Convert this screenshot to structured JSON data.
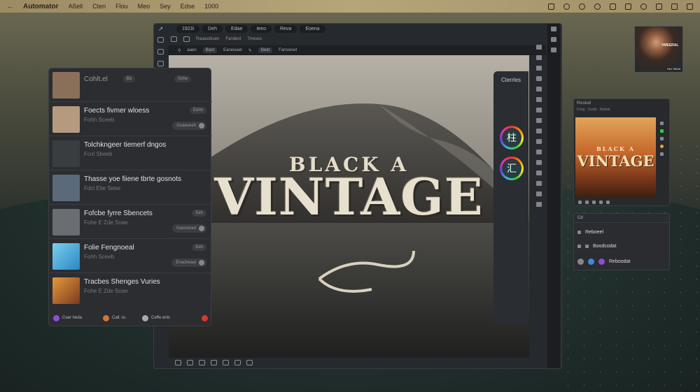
{
  "menubar": {
    "back_glyph": "←",
    "app_name": "Automator",
    "items": [
      "Aßell",
      "Cten",
      "Flou",
      "Meo",
      "Sey",
      "Edse",
      "1000"
    ]
  },
  "editor": {
    "tabs": [
      "1923i",
      "Deh",
      "Edae",
      "Ieeo",
      "Reva",
      "Eoena"
    ],
    "toolbar2": [
      "Rauasdssen",
      "Fandeot",
      "Trreseo"
    ],
    "toolbar3": [
      "aaen",
      "Baot",
      "Eaneiseet",
      "Beat",
      "Fansieset"
    ],
    "poster": {
      "top_text": "BLACK A",
      "main_text": "VINTAGE"
    },
    "styles_panel": {
      "title": "Cterrles",
      "orb1_glyph": "柱",
      "orb2_glyph": "汇"
    }
  },
  "results_panel": {
    "header": {
      "title": "Cohlt.el",
      "tab1": "Bâ",
      "tab2": "Sohe"
    },
    "items": [
      {
        "title": "Foects fivmer wloess",
        "sub": "Fohh Sceeb",
        "badge": "Eehh",
        "pill": "Goaeuesh",
        "thumb": "#b59a80"
      },
      {
        "title": "Tolchkngeer tiemerf dngos",
        "sub": "Fcnl Sbeeb",
        "badge": "",
        "pill": "",
        "thumb": "#3a3d40"
      },
      {
        "title": "Thasse yoe fiiene tbrte gosnots",
        "sub": "Fdcl Elte Sebe",
        "badge": "",
        "pill": "",
        "thumb": "#5a6a7a"
      },
      {
        "title": "Fofcbe fyrre Sbencets",
        "sub": "Fohe E Zde Soae",
        "badge": "Eeh",
        "pill": "Ganooned",
        "thumb": "#6a6e72"
      },
      {
        "title": "Folie Fengnoeal",
        "sub": "Fohh Sceeb",
        "badge": "Eeh",
        "pill": "Enacheaat",
        "thumb": "#4aa7d8"
      },
      {
        "title": "Tracbes Shenges Vuries",
        "sub": "Fohe E Zde Soae",
        "badge": "",
        "pill": "",
        "thumb": "#c76a2e"
      }
    ],
    "footer": {
      "label1": "Cuer heda",
      "label2": "Calt .tu",
      "label3": "Ceffe enls"
    }
  },
  "preview_panel": {
    "title": "Ricolod",
    "tabs": [
      "Frlog",
      "Cerdo",
      "Rolete"
    ],
    "top_text": "BLACK A",
    "main_text": "VINTAGE"
  },
  "layers_panel": {
    "title": "Cd",
    "row1": "Reboeel",
    "row2": "Boodcodat",
    "row3": "Reboodat"
  },
  "avatar_card": {
    "caption": "VMEERAL",
    "badge": "RAY BEAE"
  },
  "colors": {
    "menubar": "#b7a57a",
    "panel": "#2b2d31",
    "accent_orb": "#3bd"
  }
}
